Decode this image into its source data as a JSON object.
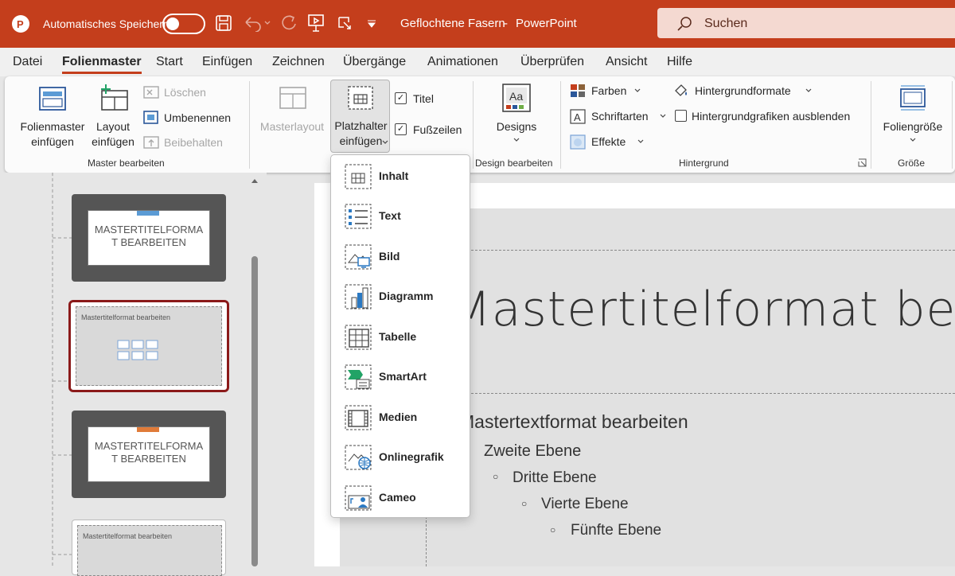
{
  "colors": {
    "accent": "#c43e1c",
    "selection_border": "#8b1a1a"
  },
  "titlebar": {
    "autosave_label": "Automatisches Speichern",
    "document": "Geflochtene Fasern",
    "sep": "-",
    "app": "PowerPoint",
    "search_placeholder": "Suchen"
  },
  "menu": [
    "Datei",
    "Folienmaster",
    "Start",
    "Einfügen",
    "Zeichnen",
    "Übergänge",
    "Animationen",
    "Überprüfen",
    "Ansicht",
    "Hilfe"
  ],
  "ribbon": {
    "insert_master_1": "Folienmaster",
    "insert_master_2": "einfügen",
    "insert_layout_1": "Layout",
    "insert_layout_2": "einfügen",
    "delete": "Löschen",
    "rename": "Umbenennen",
    "preserve": "Beibehalten",
    "group_master": "Master bearbeiten",
    "master_layout": "Masterlayout",
    "placeholder_1": "Platzhalter",
    "placeholder_2": "einfügen",
    "title_chk": "Titel",
    "footer_chk": "Fußzeilen",
    "designs": "Designs",
    "group_design": "Design bearbeiten",
    "colors": "Farben",
    "fonts": "Schriftarten",
    "effects": "Effekte",
    "bg_formats": "Hintergrundformate",
    "hide_bg": "Hintergrundgrafiken ausblenden",
    "group_bg": "Hintergrund",
    "slide_size": "Foliengröße",
    "group_size": "Größe"
  },
  "thumbnails": {
    "t1": "MASTERTITELFORMA\nT BEARBEITEN",
    "t2": "Mastertitelformat bearbeiten",
    "t3": "MASTERTITELFORMA\nT BEARBEITEN",
    "t4": "Mastertitelformat bearbeiten"
  },
  "dropdown": [
    "Inhalt",
    "Text",
    "Bild",
    "Diagramm",
    "Tabelle",
    "SmartArt",
    "Medien",
    "Onlinegrafik",
    "Cameo"
  ],
  "slide": {
    "title": "Mastertitelformat bea",
    "l1": "Mastertextformat bearbeiten",
    "l2": "Zweite Ebene",
    "l3": "Dritte Ebene",
    "l4": "Vierte Ebene",
    "l5": "Fünfte Ebene"
  }
}
